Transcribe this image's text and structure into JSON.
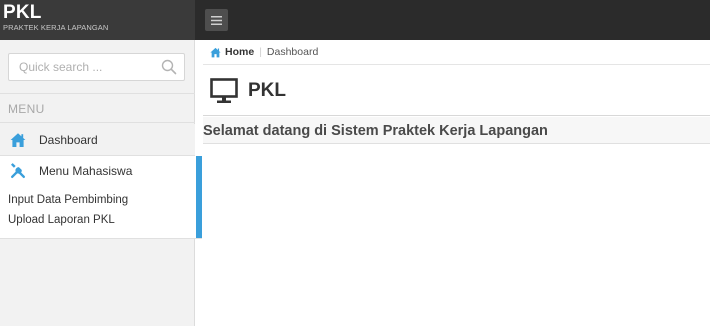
{
  "brand": {
    "title": "PKL",
    "subtitle": "PRAKTEK KERJA LAPANGAN"
  },
  "topbar": {
    "menu_toggle_icon": "hamburger-icon"
  },
  "sidebar": {
    "search": {
      "value": "",
      "placeholder": "Quick search ...",
      "icon": "search-icon"
    },
    "menu_header": "MENU",
    "items": [
      {
        "label": "Dashboard",
        "icon": "home-icon"
      },
      {
        "label": "Menu Mahasiswa",
        "icon": "tools-icon",
        "children": [
          {
            "label": "Input Data Pembimbing"
          },
          {
            "label": "Upload Laporan PKL"
          }
        ]
      }
    ]
  },
  "breadcrumb": {
    "home": "Home",
    "current": "Dashboard"
  },
  "page": {
    "title": "PKL",
    "icon": "monitor-icon",
    "welcome": "Selamat datang di Sistem Praktek Kerja Lapangan"
  },
  "colors": {
    "topbar": "#2b2b2b",
    "brand_bg": "#3a3a3a",
    "accent": "#3a9fdb",
    "sidebar_bg": "#f2f2f2"
  }
}
